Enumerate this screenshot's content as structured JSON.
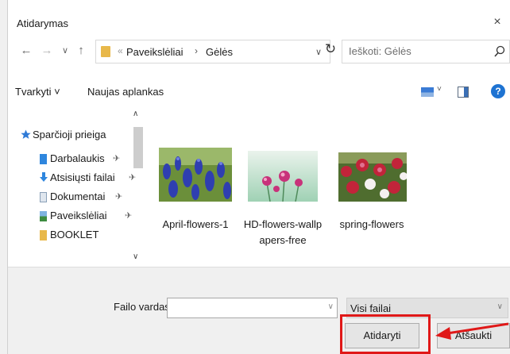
{
  "window": {
    "title": "Atidarymas",
    "close_glyph": "×"
  },
  "nav": {
    "back_glyph": "←",
    "forward_glyph": "→",
    "recent_glyph": "∨",
    "up_glyph": "↑",
    "breadcrumb": {
      "separator_first": "«",
      "segment_1": "Paveikslėliai",
      "separator": "›",
      "segment_2": "Gėlės",
      "dropdown_glyph": "∨"
    },
    "refresh_glyph": "↻",
    "search": {
      "placeholder": "Ieškoti: Gėlės",
      "value": ""
    }
  },
  "toolbar": {
    "organize_label": "Tvarkyti ˅",
    "new_folder_label": "Naujas aplankas",
    "view_dropdown_glyph": "˅",
    "help_glyph": "?"
  },
  "sidebar": {
    "scroll_up_glyph": "∧",
    "scroll_down_glyph": "∨",
    "items": [
      {
        "label": "Sparčioji prieiga",
        "icon": "star-icon",
        "pinned": false
      },
      {
        "label": "Darbalaukis",
        "icon": "desktop-folder-icon",
        "pinned": true
      },
      {
        "label": "Atsisiųsti failai",
        "icon": "downloads-icon",
        "pinned": true
      },
      {
        "label": "Dokumentai",
        "icon": "documents-icon",
        "pinned": true
      },
      {
        "label": "Paveikslėliai",
        "icon": "pictures-icon",
        "pinned": true
      },
      {
        "label": "BOOKLET",
        "icon": "folder-icon",
        "pinned": false
      }
    ],
    "pin_glyph": "✈"
  },
  "files": [
    {
      "name_line1": "April-flowers-1",
      "name_line2": "",
      "thumb": "blue-flowers-thumbnail"
    },
    {
      "name_line1": "HD-flowers-wallp",
      "name_line2": "apers-free",
      "thumb": "pink-flowers-thumbnail"
    },
    {
      "name_line1": "spring-flowers",
      "name_line2": "",
      "thumb": "red-white-flowers-thumbnail"
    }
  ],
  "footer": {
    "filename_label": "Failo vardas:",
    "filename_value": "",
    "filename_dropdown_glyph": "∨",
    "filter_value": "Visi failai",
    "filter_dropdown_glyph": "∨",
    "open_button": "Atidaryti",
    "cancel_button": "Atšaukti"
  },
  "colors": {
    "accent": "#1e73d2",
    "highlight": "#e01818",
    "folder": "#e8b84a"
  }
}
